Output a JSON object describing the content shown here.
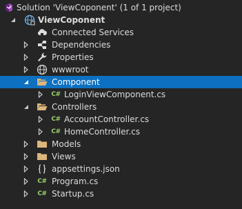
{
  "solution_explorer": {
    "rows": [
      {
        "label": "Solution 'ViewCoponent' (1 of 1 project)",
        "icon": "solution-icon"
      },
      {
        "label": "ViewCoponent",
        "icon": "web-project-icon",
        "expanded": true
      },
      {
        "label": "Connected Services",
        "icon": "connected-services-icon"
      },
      {
        "label": "Dependencies",
        "icon": "dependencies-icon",
        "expanded": false
      },
      {
        "label": "Properties",
        "icon": "wrench-icon",
        "expanded": false
      },
      {
        "label": "wwwroot",
        "icon": "globe-icon",
        "expanded": false
      },
      {
        "label": "Component",
        "icon": "folder-open-icon",
        "expanded": true,
        "selected": true
      },
      {
        "label": "LoginViewComponent.cs",
        "icon": "csharp-file-icon",
        "expanded": false
      },
      {
        "label": "Controllers",
        "icon": "folder-open-icon",
        "expanded": true
      },
      {
        "label": "AccountController.cs",
        "icon": "csharp-file-icon",
        "expanded": false
      },
      {
        "label": "HomeController.cs",
        "icon": "csharp-file-icon",
        "expanded": false
      },
      {
        "label": "Models",
        "icon": "folder-icon",
        "expanded": false
      },
      {
        "label": "Views",
        "icon": "folder-icon",
        "expanded": false
      },
      {
        "label": "appsettings.json",
        "icon": "json-file-icon",
        "expanded": false
      },
      {
        "label": "Program.cs",
        "icon": "csharp-file-icon",
        "expanded": false
      },
      {
        "label": "Startup.cs",
        "icon": "csharp-file-icon",
        "expanded": false
      }
    ],
    "csharp_glyph": "C#",
    "colors": {
      "background": "#252526",
      "text": "#dcdcdc",
      "selection": "#0e70c0",
      "folder": "#dcb67a",
      "csharp": "#9bd06a",
      "chevron": "#c8c8c8"
    }
  }
}
